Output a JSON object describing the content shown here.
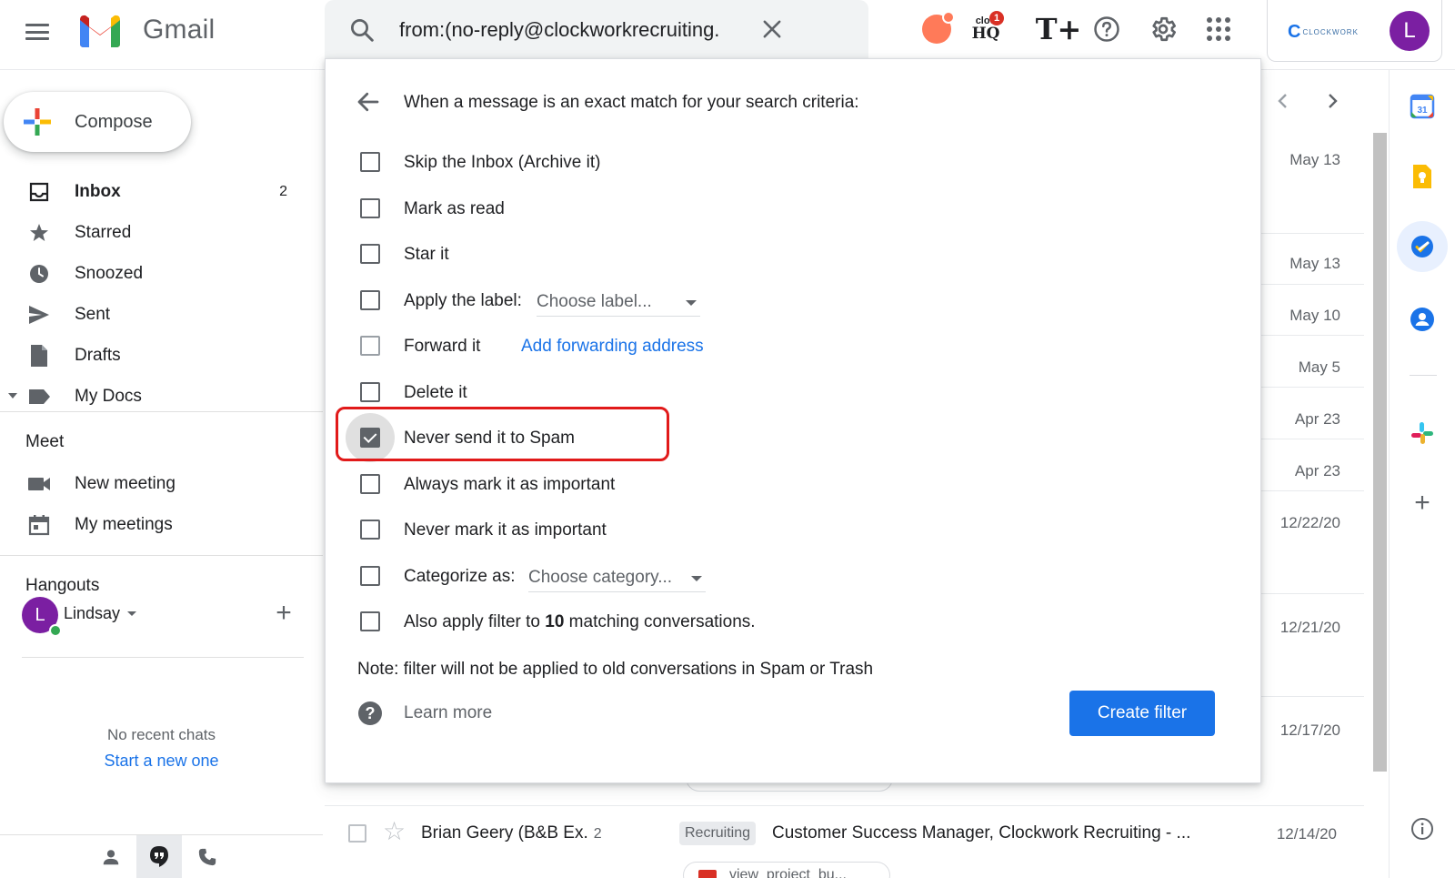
{
  "app": {
    "name": "Gmail"
  },
  "search": {
    "query": "from:(no-reply@clockworkrecruiting."
  },
  "header": {
    "cloudhq_top": "clou",
    "cloudhq_bottom": "HQ",
    "cloudhq_badge": "1",
    "tplus": "T+",
    "account_logo_text": "CLOCKWORK",
    "account_logo_letter": "C",
    "avatar_letter": "L"
  },
  "compose": {
    "label": "Compose"
  },
  "nav": {
    "items": [
      {
        "label": "Inbox",
        "count": "2",
        "icon": "inbox-icon",
        "active": true
      },
      {
        "label": "Starred",
        "count": "",
        "icon": "star-icon"
      },
      {
        "label": "Snoozed",
        "count": "",
        "icon": "clock-icon"
      },
      {
        "label": "Sent",
        "count": "",
        "icon": "send-icon"
      },
      {
        "label": "Drafts",
        "count": "",
        "icon": "draft-icon"
      },
      {
        "label": "My Docs",
        "count": "",
        "icon": "label-icon"
      }
    ]
  },
  "meet": {
    "title": "Meet",
    "items": [
      {
        "label": "New meeting",
        "icon": "video-icon"
      },
      {
        "label": "My meetings",
        "icon": "calendar-icon"
      }
    ]
  },
  "hangouts": {
    "title": "Hangouts",
    "user_name": "Lindsay",
    "user_initial": "L",
    "no_chats": "No recent chats",
    "start_new": "Start a new one"
  },
  "dates": [
    "May 13",
    "May 13",
    "May 10",
    "May 5",
    "Apr 23",
    "Apr 23",
    "12/22/20",
    "12/21/20",
    "12/17/20"
  ],
  "mail_row": {
    "sender": "Brian Geery (B&B Ex.",
    "count": "2",
    "label": "Recruiting",
    "subject": "Customer Success Manager, Clockwork Recruiting - ...",
    "date": "12/14/20",
    "attachment": "view_project_bu..."
  },
  "side_panel": {
    "calendar_day": "31"
  },
  "filter": {
    "title": "When a message is an exact match for your search criteria:",
    "options": [
      {
        "label": "Skip the Inbox (Archive it)",
        "checked": false
      },
      {
        "label": "Mark as read",
        "checked": false
      },
      {
        "label": "Star it",
        "checked": false
      },
      {
        "label": "Apply the label:",
        "checked": false,
        "dropdown": "Choose label..."
      },
      {
        "label": "Forward it",
        "checked": false,
        "link": "Add forwarding address"
      },
      {
        "label": "Delete it",
        "checked": false
      },
      {
        "label": "Never send it to Spam",
        "checked": true
      },
      {
        "label": "Always mark it as important",
        "checked": false
      },
      {
        "label": "Never mark it as important",
        "checked": false
      },
      {
        "label": "Categorize as:",
        "checked": false,
        "dropdown": "Choose category..."
      },
      {
        "label_prefix": "Also apply filter to ",
        "count": "10",
        "label_suffix": " matching conversations.",
        "checked": false
      }
    ],
    "note": "Note: filter will not be applied to old conversations in Spam or Trash",
    "learn_more": "Learn more",
    "create_button": "Create filter"
  },
  "colors": {
    "accent_blue": "#1a73e8",
    "highlight_red": "#e11a1a",
    "avatar_purple": "#7b1fa2",
    "online_green": "#34a853"
  }
}
